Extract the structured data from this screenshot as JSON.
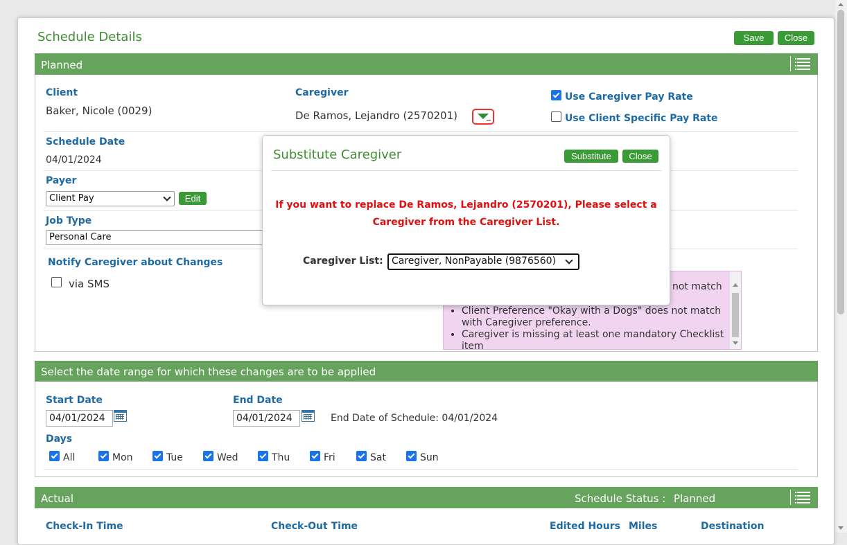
{
  "header": {
    "title": "Schedule Details",
    "save_label": "Save",
    "close_label": "Close"
  },
  "planned": {
    "band_title": "Planned",
    "client_label": "Client",
    "client_value": "Baker, Nicole (0029)",
    "caregiver_label": "Caregiver",
    "caregiver_value": "De Ramos, Lejandro (2570201)",
    "use_caregiver_pay_rate": {
      "label": "Use Caregiver Pay Rate",
      "checked": true
    },
    "use_client_pay_rate": {
      "label": "Use Client Specific Pay Rate",
      "checked": false
    },
    "schedule_date_label": "Schedule Date",
    "schedule_date_value": "04/01/2024",
    "payer_label": "Payer",
    "payer_value": "Client Pay",
    "edit_label": "Edit",
    "job_type_label": "Job Type",
    "job_type_value": "Personal Care",
    "notify_label": "Notify Caregiver about Changes",
    "via_sms_label": "via SMS",
    "warnings": [
      "not match",
      "Client Preference \"Okay with a Dogs\" does not match with Caregiver preference.",
      "Caregiver is missing at least one mandatory Checklist item"
    ]
  },
  "popup": {
    "title": "Substitute Caregiver",
    "substitute_label": "Substitute",
    "close_label": "Close",
    "message_line1": "If you want to replace De Ramos, Lejandro (2570201), Please select a",
    "message_line2": "Caregiver from the Caregiver List.",
    "list_label": "Caregiver List:",
    "list_value": "Caregiver, NonPayable (9876560)"
  },
  "date_range": {
    "band_title": "Select the date range for which these changes are to be applied",
    "start_label": "Start Date",
    "start_value": "04/01/2024",
    "end_label": "End Date",
    "end_value": "04/01/2024",
    "end_of_schedule": "End Date of Schedule: 04/01/2024",
    "days_label": "Days",
    "days": [
      {
        "label": "All",
        "checked": true
      },
      {
        "label": "Mon",
        "checked": true
      },
      {
        "label": "Tue",
        "checked": true
      },
      {
        "label": "Wed",
        "checked": true
      },
      {
        "label": "Thu",
        "checked": true
      },
      {
        "label": "Fri",
        "checked": true
      },
      {
        "label": "Sat",
        "checked": true
      },
      {
        "label": "Sun",
        "checked": true
      }
    ]
  },
  "actual": {
    "band_title": "Actual",
    "status_label": "Schedule Status :",
    "status_value": "Planned",
    "columns": [
      "Check-In Time",
      "Check-Out Time",
      "Edited Hours",
      "Miles",
      "Destination"
    ]
  },
  "colors": {
    "accent_green": "#66a35d",
    "button_green": "#3a9a36",
    "label_blue": "#1d6aa5",
    "error_red": "#e01010"
  }
}
